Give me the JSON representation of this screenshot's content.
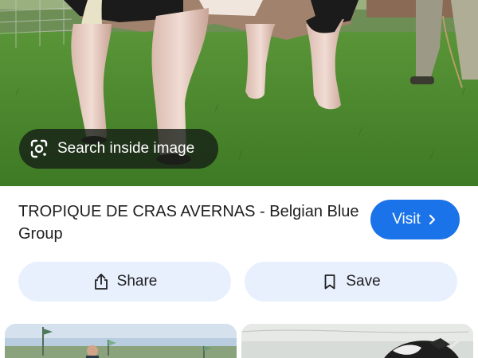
{
  "hero": {
    "image_description_icon": "cow-photo",
    "search_inside_label": "Search inside image"
  },
  "result": {
    "title": "TROPIQUE DE CRAS AVERNAS - Belgian Blue Group",
    "visit_label": "Visit"
  },
  "actions": {
    "share_label": "Share",
    "save_label": "Save"
  },
  "colors": {
    "accent": "#1a73e8",
    "action_bg": "#e8f0fe",
    "text": "#1f1f1f",
    "chip_bg": "#141c16"
  },
  "icons": {
    "lens": "google-lens-icon",
    "visit": "chevron-right-icon",
    "share": "share-icon",
    "save": "bookmark-icon"
  }
}
